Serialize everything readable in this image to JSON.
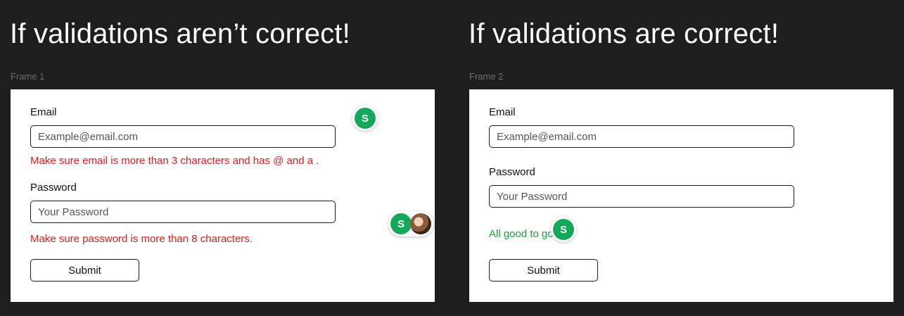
{
  "left": {
    "heading": "If validations aren’t correct!",
    "frame_label": "Frame 1",
    "email_label": "Email",
    "email_placeholder": "Example@email.com",
    "email_error": "Make sure email is more than 3 characters and has @ and a .",
    "password_label": "Password",
    "password_placeholder": "Your Password",
    "password_error": "Make sure password is more than 8 characters.",
    "submit_label": "Submit",
    "collaborators": [
      "S",
      "S"
    ]
  },
  "right": {
    "heading": "If validations are correct!",
    "frame_label": "Frame 2",
    "email_label": "Email",
    "email_placeholder": "Example@email.com",
    "password_label": "Password",
    "password_placeholder": "Your Password",
    "success_message": "All good to go",
    "submit_label": "Submit",
    "collaborators": [
      "S"
    ]
  },
  "colors": {
    "background": "#1e1e1e",
    "error": "#e01b1b",
    "success": "#1e9e3a",
    "avatar": "#13a85a"
  }
}
